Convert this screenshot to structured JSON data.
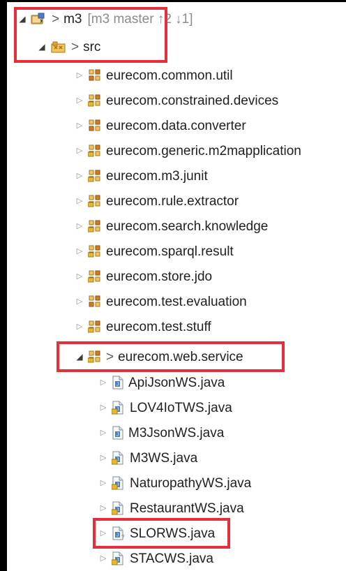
{
  "tree": {
    "project": {
      "name": "m3",
      "status": "[m3 master ↑2 ↓1]"
    },
    "source_folder": {
      "label": "src"
    },
    "packages": [
      {
        "label": "eurecom.common.util"
      },
      {
        "label": "eurecom.constrained.devices"
      },
      {
        "label": "eurecom.data.converter"
      },
      {
        "label": "eurecom.generic.m2mapplication"
      },
      {
        "label": "eurecom.m3.junit"
      },
      {
        "label": "eurecom.rule.extractor"
      },
      {
        "label": "eurecom.search.knowledge"
      },
      {
        "label": "eurecom.sparql.result"
      },
      {
        "label": "eurecom.store.jdo"
      },
      {
        "label": "eurecom.test.evaluation"
      },
      {
        "label": "eurecom.test.stuff"
      }
    ],
    "open_package": {
      "label": "eurecom.web.service"
    },
    "files": [
      {
        "label": "ApiJsonWS.java"
      },
      {
        "label": "LOV4IoTWS.java"
      },
      {
        "label": "M3JsonWS.java"
      },
      {
        "label": "M3WS.java"
      },
      {
        "label": "NaturopathyWS.java"
      },
      {
        "label": "RestaurantWS.java"
      },
      {
        "label": "SLORWS.java"
      },
      {
        "label": "STACWS.java"
      }
    ]
  },
  "colors": {
    "highlight": "#e52f3b",
    "package_orange": "#d47c1d",
    "package_gold": "#d8a533",
    "java_blue": "#4c7cc1",
    "warning_yellow": "#e5b82f"
  }
}
